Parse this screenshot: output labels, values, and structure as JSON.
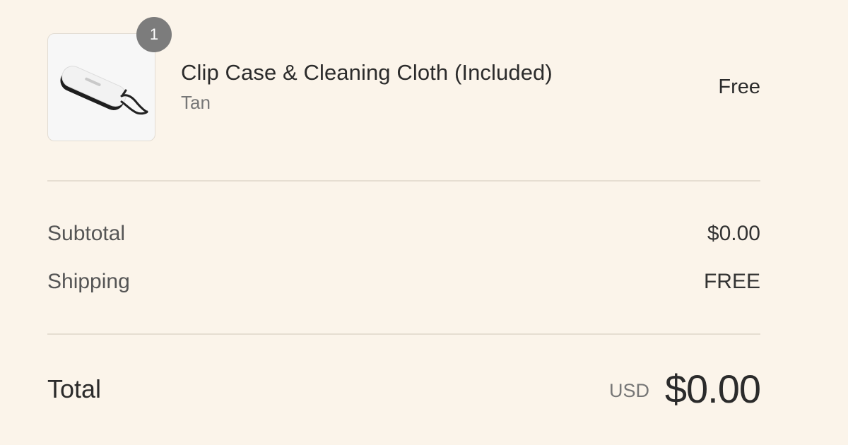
{
  "order_item": {
    "quantity": "1",
    "name": "Clip Case & Cleaning Cloth (Included)",
    "variant": "Tan",
    "price": "Free",
    "image_icon": "glasses-clip-case-icon"
  },
  "subtotal": {
    "label": "Subtotal",
    "value": "$0.00"
  },
  "shipping": {
    "label": "Shipping",
    "value": "FREE"
  },
  "total": {
    "label": "Total",
    "currency": "USD",
    "amount": "$0.00"
  },
  "colors": {
    "background": "#fbf4ea",
    "badge": "#7c7c7c",
    "divider": "#e6ded2"
  }
}
